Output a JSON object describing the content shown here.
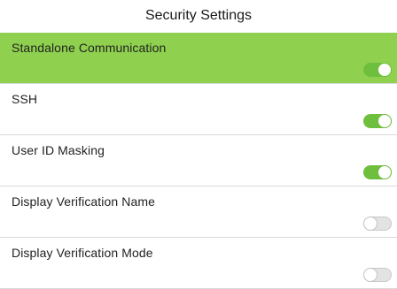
{
  "header": {
    "title": "Security Settings"
  },
  "settings": [
    {
      "label": "Standalone Communication",
      "enabled": true,
      "selected": true
    },
    {
      "label": "SSH",
      "enabled": true,
      "selected": false
    },
    {
      "label": "User ID Masking",
      "enabled": true,
      "selected": false
    },
    {
      "label": "Display Verification Name",
      "enabled": false,
      "selected": false
    },
    {
      "label": "Display Verification Mode",
      "enabled": false,
      "selected": false
    }
  ],
  "colors": {
    "selected_row": "#8fd14f",
    "toggle_on": "#6fbf3f",
    "toggle_off": "#e3e3e3"
  }
}
